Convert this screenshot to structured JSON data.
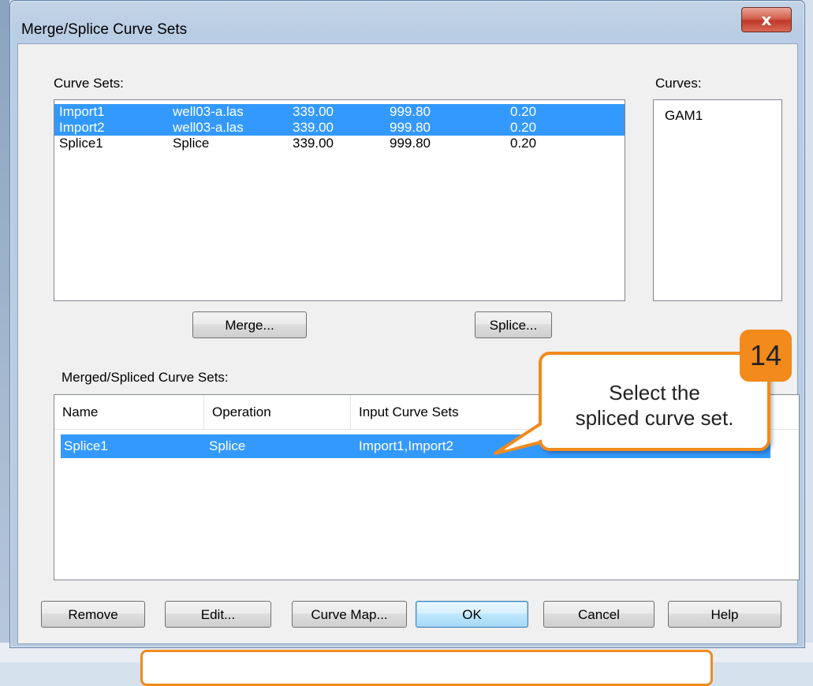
{
  "window": {
    "title": "Merge/Splice Curve Sets",
    "close_glyph": "x"
  },
  "curve_sets": {
    "label": "Curve Sets:",
    "rows": [
      {
        "name": "Import1",
        "source": "well03-a.las",
        "start": "339.00",
        "stop": "999.80",
        "step": "0.20",
        "selected": true
      },
      {
        "name": "Import2",
        "source": "well03-a.las",
        "start": "339.00",
        "stop": "999.80",
        "step": "0.20",
        "selected": true
      },
      {
        "name": "Splice1",
        "source": "Splice",
        "start": "339.00",
        "stop": "999.80",
        "step": "0.20",
        "selected": false
      }
    ]
  },
  "curves": {
    "label": "Curves:",
    "items": [
      "GAM1"
    ]
  },
  "actions": {
    "merge": "Merge...",
    "splice": "Splice..."
  },
  "merged": {
    "label": "Merged/Spliced Curve Sets:",
    "columns": [
      "Name",
      "Operation",
      "Input Curve Sets"
    ],
    "rows": [
      {
        "name": "Splice1",
        "operation": "Splice",
        "inputs": "Import1,Import2",
        "selected": true
      }
    ]
  },
  "buttons": {
    "remove": "Remove",
    "edit": "Edit...",
    "curve_map": "Curve Map...",
    "ok": "OK",
    "cancel": "Cancel",
    "help": "Help"
  },
  "callout": {
    "step": "14",
    "line1": "Select the",
    "line2": "spliced curve set.",
    "color": "#f28a1c"
  }
}
